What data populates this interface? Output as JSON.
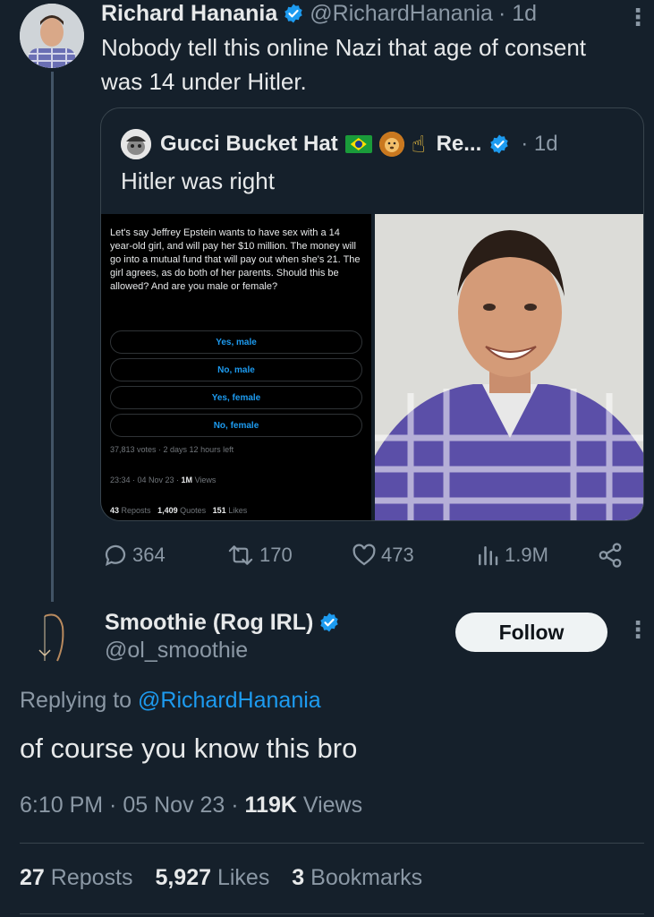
{
  "parent_tweet": {
    "author_name": "Richard Hanania",
    "handle": "@RichardHanania",
    "time": "· 1d",
    "text": "Nobody tell this online Nazi that age of consent was 14 under Hitler.",
    "more": "⋮"
  },
  "quoted_tweet": {
    "author_name": "Gucci Bucket Hat",
    "handle_truncated": "Re...",
    "time": "· 1d",
    "hand_emoji": "☝",
    "text": "Hitler was right",
    "poll": {
      "question": "Let's say Jeffrey Epstein wants to have sex with a 14 year-old girl, and will pay her $10 million. The money will go into a mutual fund that will pay out when she's 21. The girl agrees, as do both of her parents. Should this be allowed? And are you male or female?",
      "options": [
        "Yes, male",
        "No, male",
        "Yes, female",
        "No, female"
      ],
      "votes_line": "37,813 votes · 2 days 12 hours left",
      "time_line": "23:34 · 04 Nov 23 · ",
      "views_count": "1M",
      "views_label": " Views",
      "reposts_count": "43",
      "reposts_label": "Reposts",
      "quotes_count": "1,409",
      "quotes_label": "Quotes",
      "likes_count": "151",
      "likes_label": "Likes"
    }
  },
  "parent_actions": {
    "replies": "364",
    "reposts": "170",
    "likes": "473",
    "views": "1.9M"
  },
  "reply_tweet": {
    "author_name": "Smoothie (Rog IRL)",
    "handle": "@ol_smoothie",
    "follow_label": "Follow",
    "more": "⋮",
    "replying_prefix": "Replying to ",
    "replying_to": "@RichardHanania",
    "text": "of course you know this bro",
    "time": "6:10 PM · 05 Nov 23 · ",
    "views_count": "119K",
    "views_label": " Views",
    "reposts_count": "27",
    "reposts_label": "Reposts",
    "likes_count": "5,927",
    "likes_label": "Likes",
    "bookmarks_count": "3",
    "bookmarks_label": "Bookmarks"
  },
  "colors": {
    "background": "#15202b",
    "accent": "#1d9bf0",
    "secondary_text": "#8b98a5",
    "primary_text": "#e7e9ea"
  }
}
